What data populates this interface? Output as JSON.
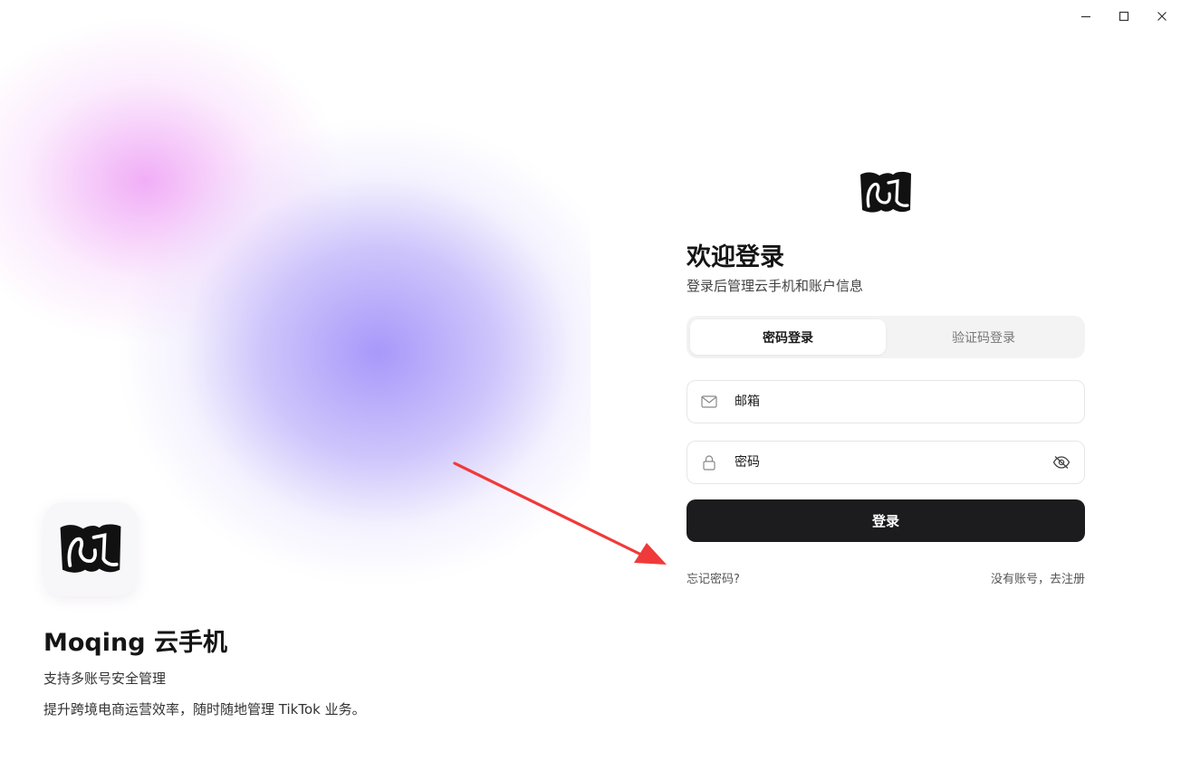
{
  "window_controls": {
    "minimize_icon": "minimize-icon",
    "maximize_icon": "maximize-icon",
    "close_icon": "close-icon"
  },
  "hero": {
    "app_name": "Moqing 云手机",
    "tagline_1": "支持多账号安全管理",
    "tagline_2": "提升跨境电商运营效率，随时随地管理 TikTok 业务。",
    "gradient_colors": [
      "#EEA0F5",
      "#A898FA"
    ]
  },
  "login": {
    "title": "欢迎登录",
    "subtitle": "登录后管理云手机和账户信息",
    "tabs": [
      {
        "label": "密码登录",
        "active": true
      },
      {
        "label": "验证码登录",
        "active": false
      }
    ],
    "email": {
      "placeholder": "邮箱",
      "value": "",
      "icon": "mail-icon"
    },
    "password": {
      "placeholder": "密码",
      "value": "",
      "icon": "lock-icon",
      "toggle_icon": "eye-off-icon"
    },
    "submit_label": "登录",
    "forgot_label": "忘记密码?",
    "register_label": "没有账号，去注册",
    "button_color": "#1C1C1E"
  },
  "annotation": {
    "type": "arrow",
    "color": "#F03A3A",
    "points_to": "forgot-password-link"
  }
}
